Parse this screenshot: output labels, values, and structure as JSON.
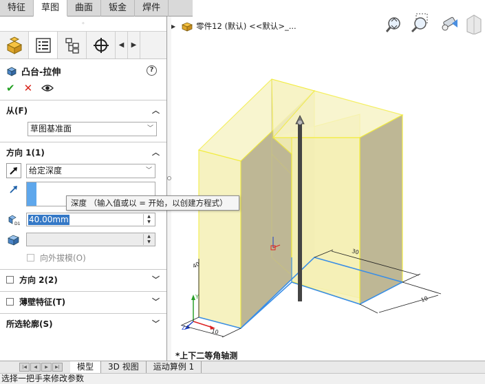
{
  "command_tabs": [
    "特征",
    "草图",
    "曲面",
    "钣金",
    "焊件"
  ],
  "active_command_tab": 1,
  "panel_grip": "◦",
  "manager_tabs": [
    "feature-manager",
    "property-manager",
    "configuration-manager",
    "dimxpert-manager"
  ],
  "feature": {
    "title": "凸台-拉伸",
    "help": "?"
  },
  "actions": {
    "ok": "✔",
    "cancel": "✕"
  },
  "from_group": {
    "title": "从(F)",
    "value": "草图基准面"
  },
  "direction1": {
    "title": "方向 1(1)",
    "end_condition": "给定深度",
    "depth": "40.00mm",
    "draft_outward": "向外拔模(O)"
  },
  "tooltip": "深度  （输入值或以 = 开始，以创建方程式）",
  "direction2": {
    "title": "方向 2(2)"
  },
  "thin_feature": {
    "title": "薄壁特征(T)"
  },
  "selected_contours": {
    "title": "所选轮廓(S)"
  },
  "graphics": {
    "part_label": "零件12 (默认) <<默认>_...",
    "view_name": "*上下二等角轴测",
    "dim_30": "30",
    "dim_10a": "10",
    "dim_10b": "10",
    "dim_40": "40"
  },
  "bottom_tabs": [
    "模型",
    "3D 视图",
    "运动算例 1"
  ],
  "status_text": "选择一把手来修改参数",
  "colors": {
    "preview_fill": "#f5f0b6",
    "preview_edge": "#f2ec3a",
    "sketch": "#3a8ee6",
    "accent_blue": "#5ea7ec"
  }
}
